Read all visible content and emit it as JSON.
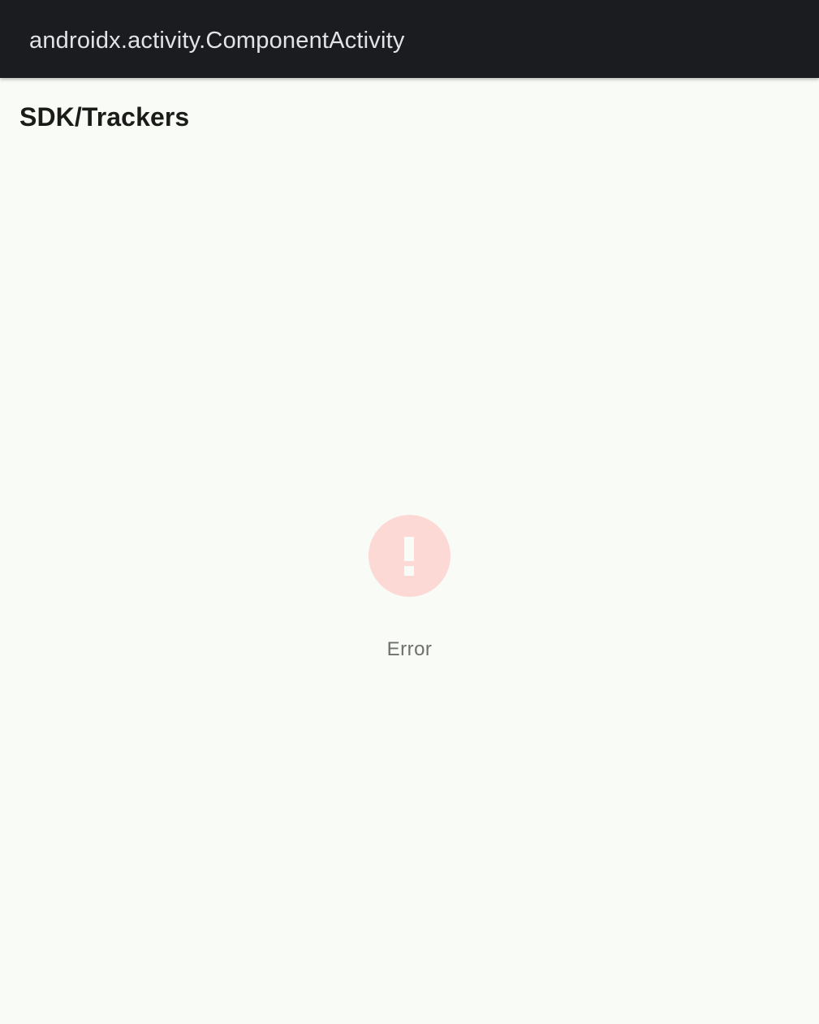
{
  "app_bar": {
    "title": "androidx.activity.ComponentActivity"
  },
  "page": {
    "title": "SDK/Trackers"
  },
  "error_state": {
    "icon": "error-exclamation-icon",
    "message": "Error"
  },
  "colors": {
    "app_bar_background": "#1b1c20",
    "page_background": "#f9fbf7",
    "error_icon_background": "#fdd9d6"
  }
}
